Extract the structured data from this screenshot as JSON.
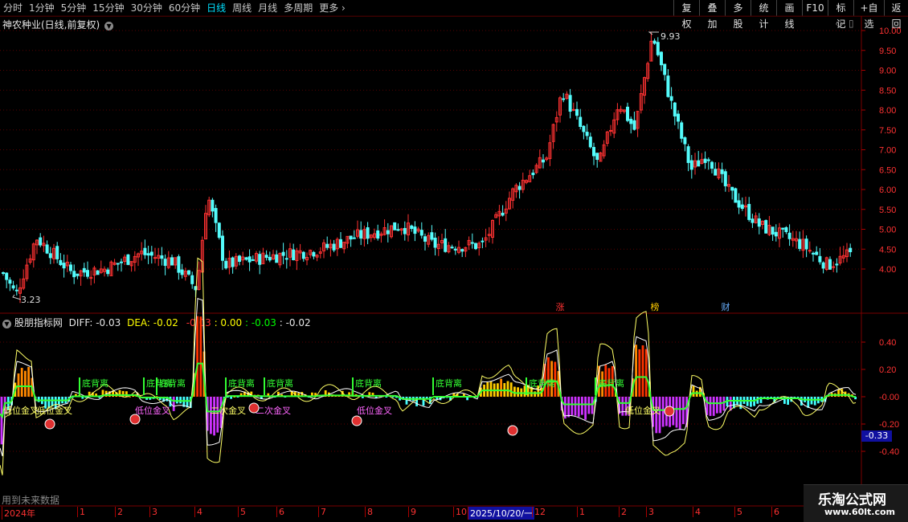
{
  "toolbar": {
    "periods": [
      "分时",
      "1分钟",
      "5分钟",
      "15分钟",
      "30分钟",
      "60分钟",
      "日线",
      "周线",
      "月线",
      "多周期",
      "更多"
    ],
    "active_period": "日线",
    "right_buttons": [
      "复权",
      "叠加",
      "多股",
      "统计",
      "画线",
      "F10",
      "标记",
      "+自选",
      "返回"
    ]
  },
  "main": {
    "title": "神农种业(日线,前复权)",
    "y_ticks": [
      "10.00",
      "9.50",
      "9.00",
      "8.50",
      "8.00",
      "7.50",
      "7.00",
      "6.50",
      "6.00",
      "5.50",
      "5.00",
      "4.50",
      "4.00"
    ],
    "high_label": "9.93",
    "low_label": "3.23",
    "badges": [
      "涨",
      "榜",
      "财"
    ]
  },
  "indicator": {
    "name": "股朋指标网",
    "diff_label": "DIFF:",
    "diff_value": "-0.03",
    "dea_label": "DEA:",
    "dea_value": "-0.02",
    "v1": "-0.03",
    "v2": ": 0.00",
    "v3": ": -0.03",
    "v4": ": -0.02",
    "y_ticks": [
      "0.40",
      "0.20",
      "-0.00",
      "-0.20",
      "-0.40"
    ],
    "current_tag": "-0.33",
    "signal_labels": [
      "底背离",
      "底背离",
      "底背离",
      "底背离",
      "底背离",
      "底背离",
      "底背离",
      "底背离",
      "底背离"
    ],
    "cross_labels": [
      "低位金叉",
      "低位金叉",
      "低位金叉",
      "二次金叉",
      "二次金叉",
      "低位金叉",
      "低位金叉"
    ],
    "footer_note": "用到未来数据"
  },
  "timeline": {
    "labels": [
      "2024年",
      "1",
      "2",
      "3",
      "4",
      "5",
      "6",
      "7",
      "8",
      "9",
      "10",
      "2025/10/20/一",
      "12",
      "1",
      "2",
      "3",
      "4",
      "5",
      "6"
    ]
  },
  "watermark": {
    "title": "乐淘公式网",
    "url": "www.60lt.com"
  },
  "colors": {
    "up": "#ff3232",
    "down": "#54fcfc",
    "ma": "#ffffff",
    "grid": "#3a0000"
  },
  "chart_data": {
    "type": "candlestick",
    "price_range": [
      3.23,
      9.93
    ],
    "indicator_range": [
      -0.5,
      0.5
    ]
  }
}
